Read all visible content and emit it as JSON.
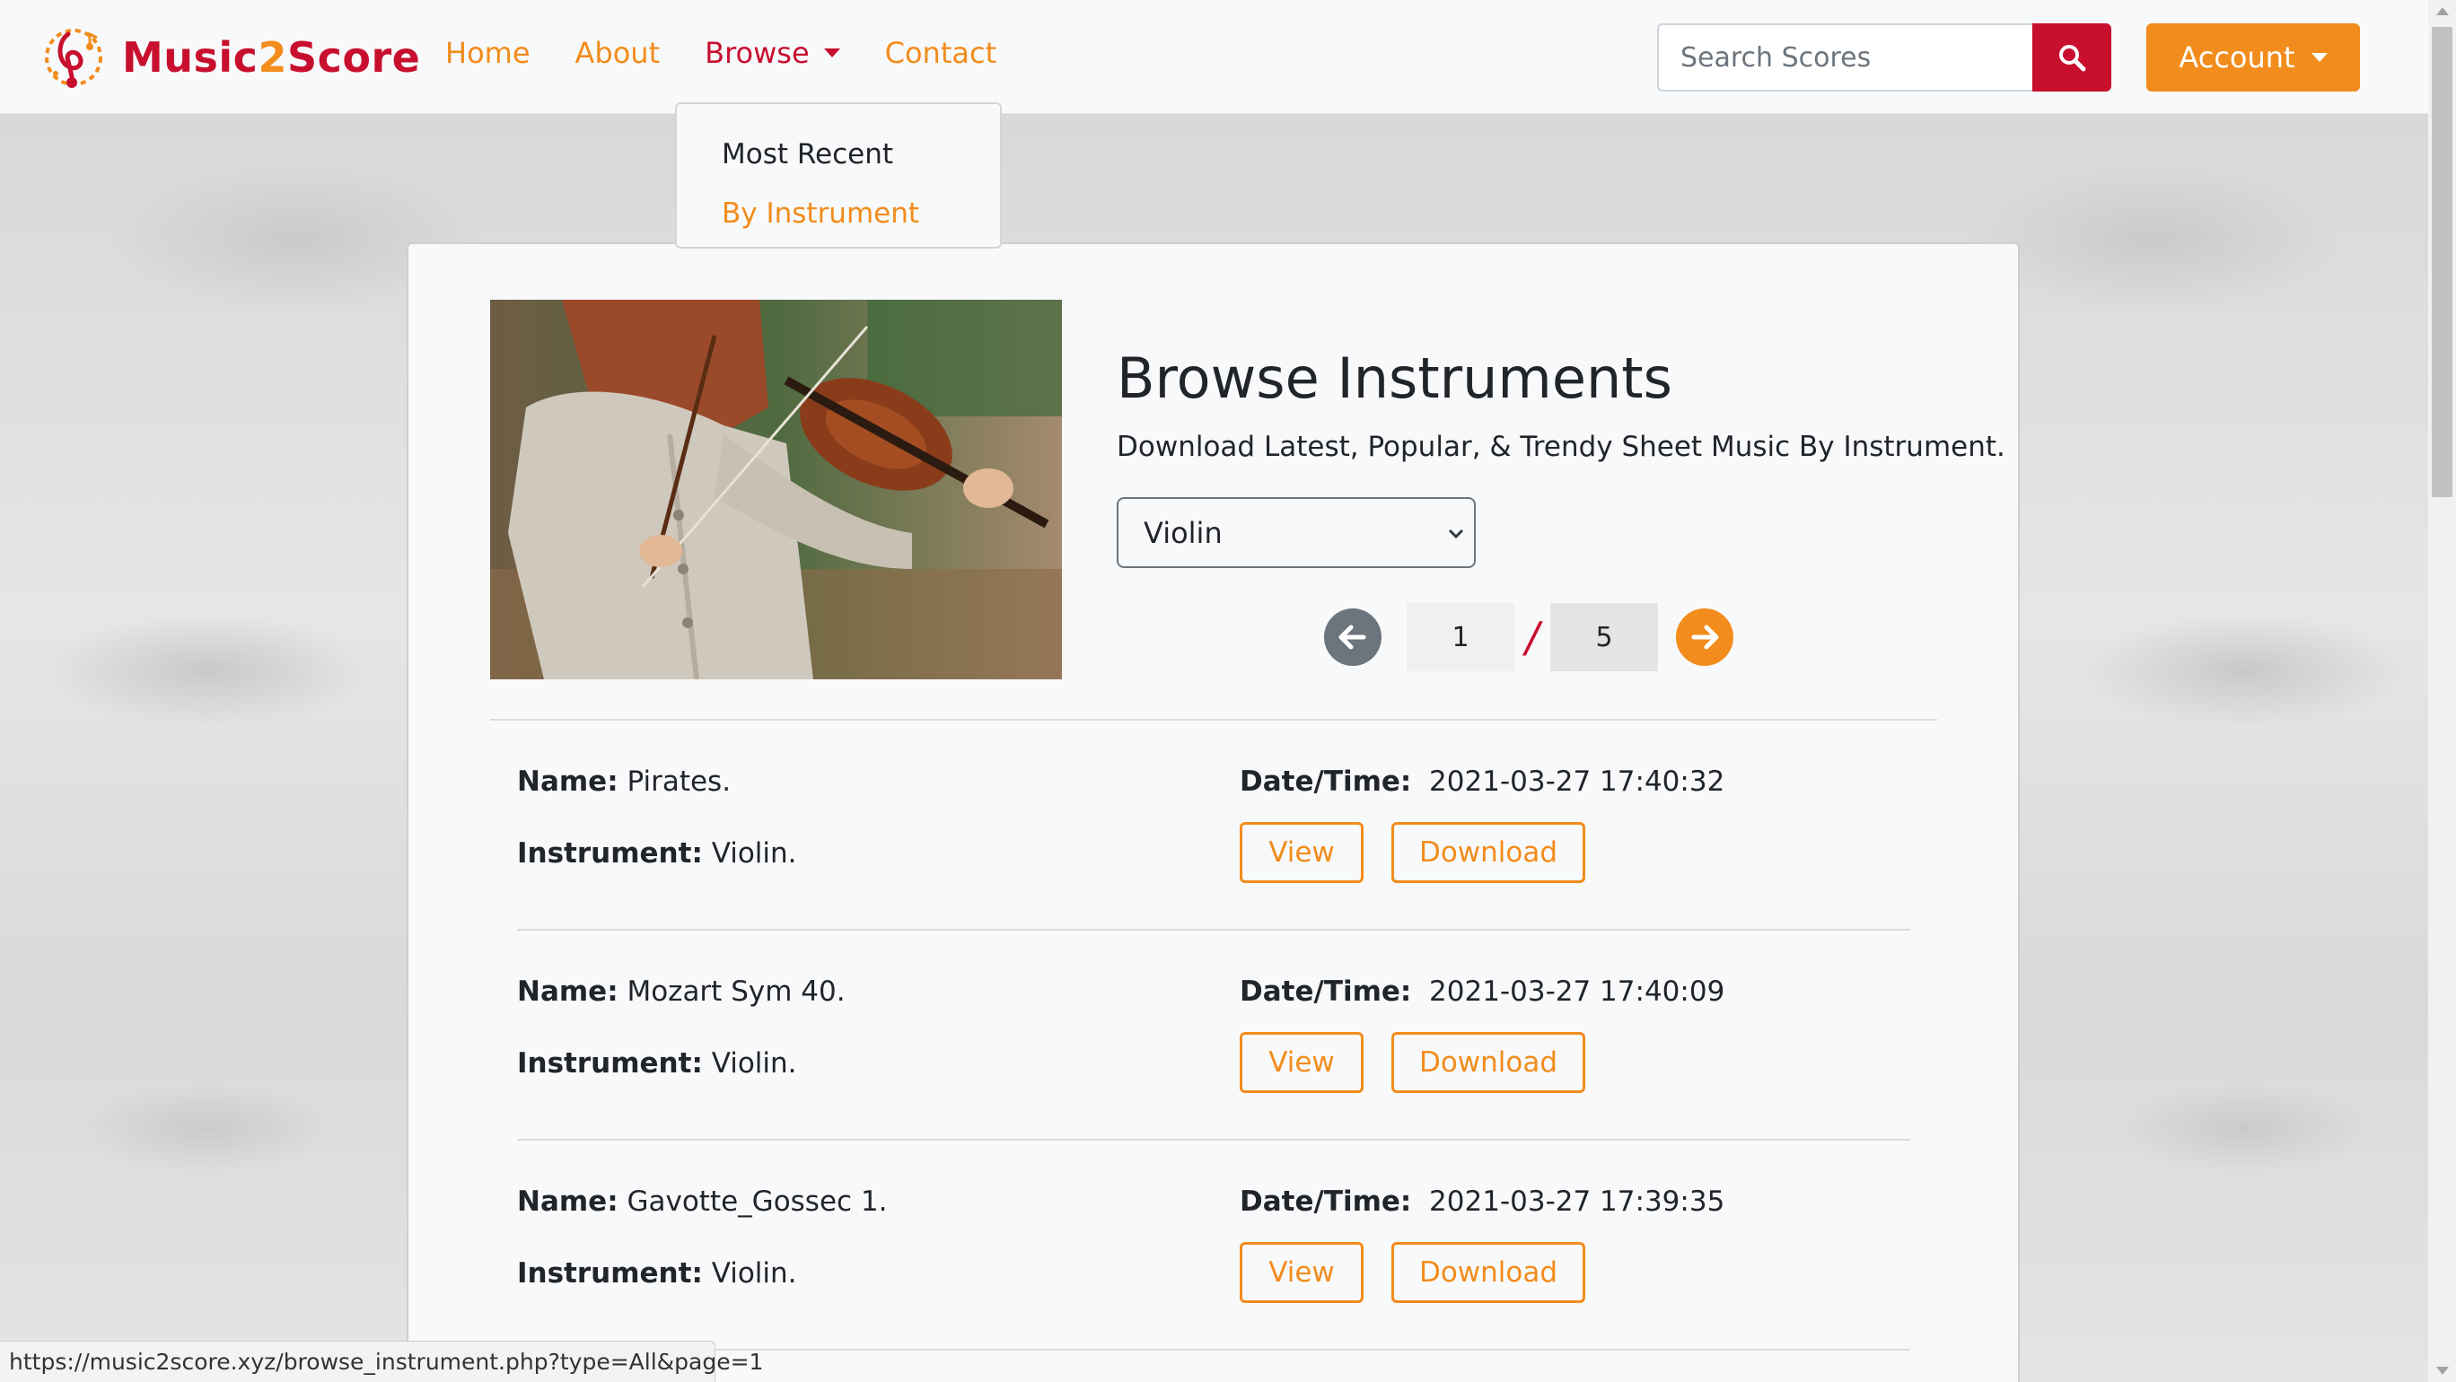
{
  "brand": {
    "name_part1": "Music",
    "name_part2": "2",
    "name_part3": "Score"
  },
  "nav": {
    "home": "Home",
    "about": "About",
    "browse": "Browse",
    "contact": "Contact",
    "dropdown": [
      "Most Recent",
      "By Instrument"
    ]
  },
  "search": {
    "placeholder": "Search Scores",
    "icon": "search-icon"
  },
  "account": {
    "label": "Account"
  },
  "hero": {
    "title": "Browse Instruments",
    "subtitle": "Download Latest, Popular, & Trendy Sheet Music By Instrument.",
    "selected_instrument": "Violin"
  },
  "pagination": {
    "current": "1",
    "separator": "/",
    "total": "5"
  },
  "items": [
    {
      "name_label": "Name:",
      "name": "Pirates.",
      "instrument_label": "Instrument:",
      "instrument": "Violin.",
      "date_label": "Date/Time:",
      "date": "2021-03-27 17:40:32",
      "view": "View",
      "download": "Download"
    },
    {
      "name_label": "Name:",
      "name": "Mozart Sym 40.",
      "instrument_label": "Instrument:",
      "instrument": "Violin.",
      "date_label": "Date/Time:",
      "date": "2021-03-27 17:40:09",
      "view": "View",
      "download": "Download"
    },
    {
      "name_label": "Name:",
      "name": "Gavotte_Gossec 1.",
      "instrument_label": "Instrument:",
      "instrument": "Violin.",
      "date_label": "Date/Time:",
      "date": "2021-03-27 17:39:35",
      "view": "View",
      "download": "Download"
    }
  ],
  "status_bar": {
    "url": "https://music2score.xyz/browse_instrument.php?type=All&page=1"
  },
  "colors": {
    "brand_red": "#c8102e",
    "brand_orange": "#f28c1c"
  }
}
